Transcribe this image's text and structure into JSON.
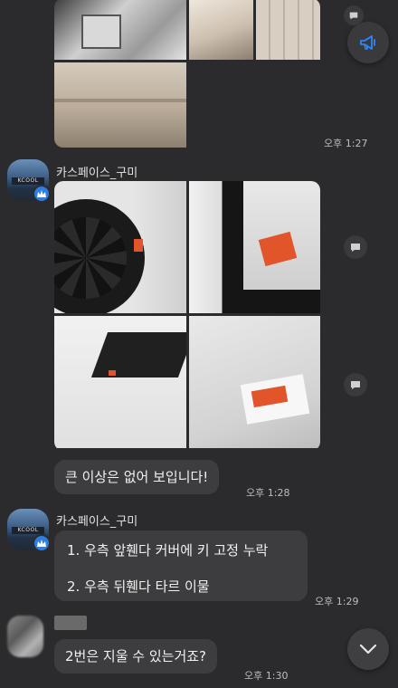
{
  "colors": {
    "background": "#2b2b2d",
    "bubble": "#3d3d40",
    "text": "#f1f1f1",
    "timestamp": "#bdbdbd",
    "badge": "#2f7de1",
    "accent_marker": "#e2542a"
  },
  "top_group": {
    "time": "오후 1:27"
  },
  "message_group_1": {
    "sender": "카스페이스_구미",
    "avatar_sign": "KCOOL",
    "photos_time": "",
    "text": "큰 이상은 없어 보입니다!",
    "time": "오후 1:28"
  },
  "message_group_2": {
    "sender": "카스페이스_구미",
    "avatar_sign": "KCOOL",
    "lines": [
      "1. 우측 앞휀다 커버에 키 고정 누락",
      "2. 우측 뒤휀다 타르 이물"
    ],
    "time": "오후 1:29"
  },
  "user_message": {
    "text": "2번은 지울 수 있는거죠?",
    "time": "오후 1:30"
  },
  "icons": {
    "announcement": "megaphone-icon",
    "share": "share-icon",
    "scroll_down": "chevron-down-icon",
    "badge": "crown-icon"
  }
}
